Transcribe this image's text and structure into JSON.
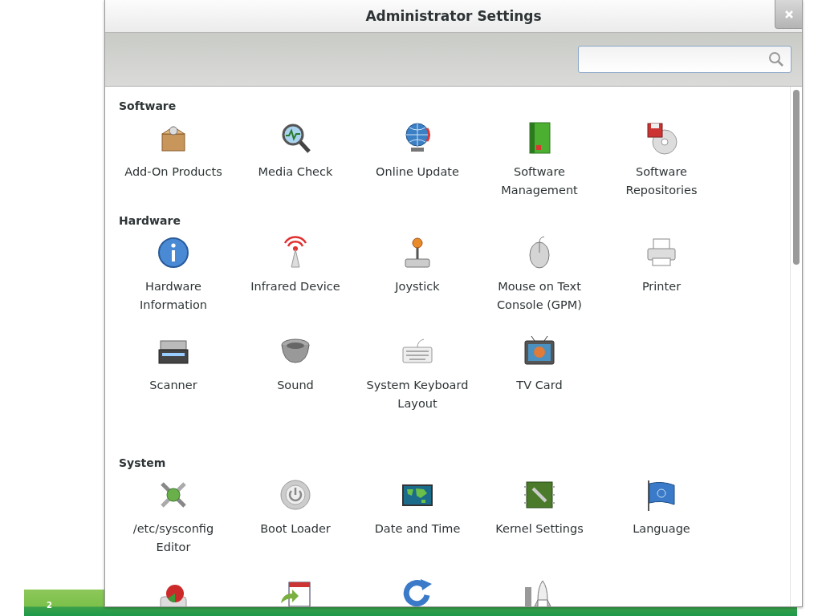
{
  "window": {
    "title": "Administrator Settings"
  },
  "sections": [
    {
      "title": "Software",
      "items": [
        {
          "label": "Add-On Products"
        },
        {
          "label": "Media Check"
        },
        {
          "label": "Online Update"
        },
        {
          "label": "Software Management"
        },
        {
          "label": "Software Repositories"
        }
      ]
    },
    {
      "title": "Hardware",
      "items": [
        {
          "label": "Hardware Information"
        },
        {
          "label": "Infrared Device"
        },
        {
          "label": "Joystick"
        },
        {
          "label": "Mouse on Text Console (GPM)"
        },
        {
          "label": "Printer"
        },
        {
          "label": "Scanner"
        },
        {
          "label": "Sound"
        },
        {
          "label": "System Keyboard Layout"
        },
        {
          "label": "TV Card"
        }
      ]
    },
    {
      "title": "System",
      "items": [
        {
          "label": "/etc/sysconfig Editor"
        },
        {
          "label": "Boot Loader"
        },
        {
          "label": "Date and Time"
        },
        {
          "label": "Kernel Settings"
        },
        {
          "label": "Language"
        }
      ]
    }
  ],
  "slide": {
    "page_number": "2"
  }
}
